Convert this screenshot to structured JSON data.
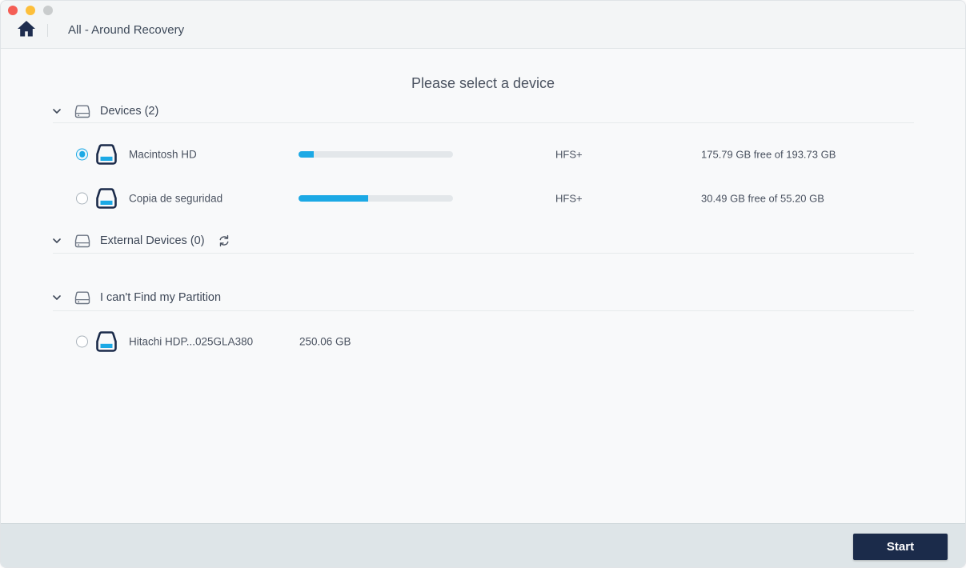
{
  "colors": {
    "accent": "#1ca9e5",
    "navy": "#1b2b4a",
    "track": "#e3e7ea"
  },
  "window": {
    "title": "All - Around Recovery"
  },
  "main": {
    "heading": "Please select a device"
  },
  "sections": {
    "devices": {
      "label": "Devices (2)"
    },
    "external": {
      "label": "External Devices (0)"
    },
    "partition": {
      "label": "I can't Find my Partition"
    }
  },
  "devices": [
    {
      "name": "Macintosh HD",
      "selected": true,
      "used_pct": 10,
      "filesystem": "HFS+",
      "free_space": "175.79 GB free of 193.73 GB"
    },
    {
      "name": "Copia de seguridad",
      "selected": false,
      "used_pct": 45,
      "filesystem": "HFS+",
      "free_space": "30.49 GB free of 55.20 GB"
    }
  ],
  "partitions": [
    {
      "name": "Hitachi HDP...025GLA380",
      "selected": false,
      "size": "250.06 GB"
    }
  ],
  "footer": {
    "start_label": "Start"
  }
}
